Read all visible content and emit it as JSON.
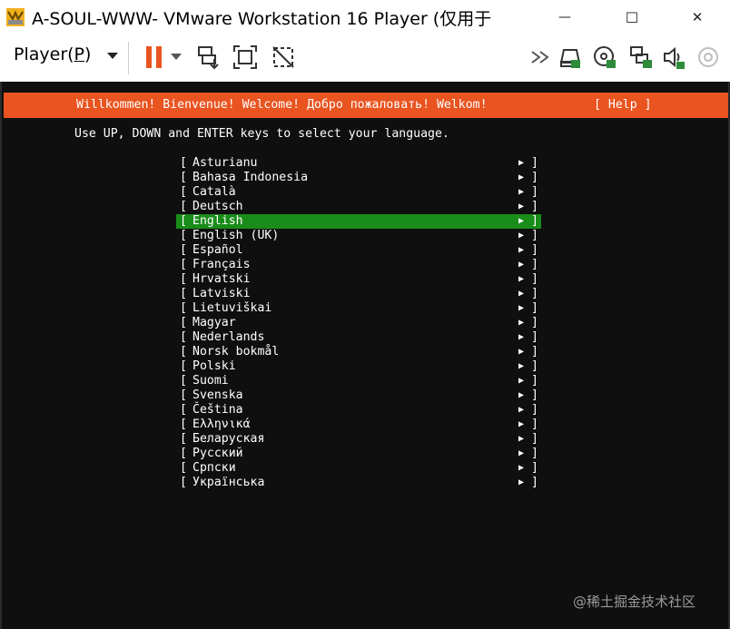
{
  "window": {
    "title": "A-SOUL-WWW- VMware Workstation 16 Player (仅用于",
    "minimize_glyph": "—",
    "maximize_glyph": "☐",
    "close_glyph": "✕"
  },
  "toolbar": {
    "player_menu": "Player(P)",
    "icons": [
      "pause-icon",
      "dropdown-caret-icon",
      "send-ctrl-alt-del-icon",
      "fit-guest-icon",
      "unity-icon",
      "double-chevron-icon",
      "hard-disk-icon",
      "cd-dvd-icon",
      "network-icon",
      "sound-icon",
      "usb-icon"
    ]
  },
  "installer": {
    "banner": "Willkommen! Bienvenue! Welcome! Добро пожаловать! Welkom!",
    "help": "[ Help ]",
    "instruction": "Use UP, DOWN and ENTER keys to select your language.",
    "selected_index": 4,
    "languages": [
      "Asturianu",
      "Bahasa Indonesia",
      "Català",
      "Deutsch",
      "English",
      "English (UK)",
      "Español",
      "Français",
      "Hrvatski",
      "Latviski",
      "Lietuviškai",
      "Magyar",
      "Nederlands",
      "Norsk bokmål",
      "Polski",
      "Suomi",
      "Svenska",
      "Čeština",
      "Ελληνικά",
      "Беларуская",
      "Русский",
      "Српски",
      "Українська"
    ],
    "bracket_left": "[",
    "bracket_right": "]",
    "arrow": "▶"
  },
  "watermark": "@稀土掘金技术社区",
  "colors": {
    "banner": "#e95420",
    "selection": "#1a8c1a",
    "terminal_bg": "#0f0f0f",
    "pause": "#e95420"
  }
}
